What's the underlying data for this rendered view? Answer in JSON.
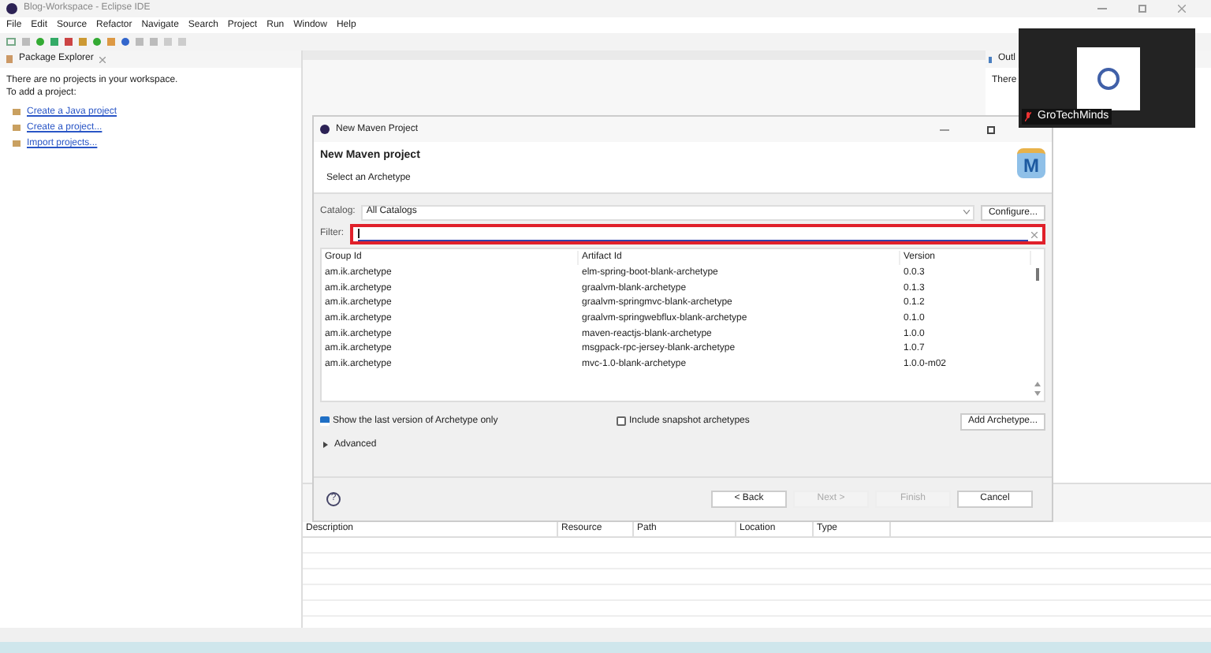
{
  "window": {
    "title": "Blog-Workspace - Eclipse IDE"
  },
  "menu": [
    "File",
    "Edit",
    "Source",
    "Refactor",
    "Navigate",
    "Search",
    "Project",
    "Run",
    "Window",
    "Help"
  ],
  "package_explorer": {
    "title": "Package Explorer",
    "message": [
      "There are no projects in your workspace.",
      "To add a project:"
    ],
    "links": [
      "Create a Java project",
      "Create a project...",
      "Import projects..."
    ]
  },
  "outline": {
    "title": "Outl",
    "text": "There"
  },
  "problems": {
    "columns": [
      "Description",
      "Resource",
      "Path",
      "Location",
      "Type"
    ]
  },
  "dialog": {
    "title": "New Maven Project",
    "heading": "New Maven project",
    "subtitle": "Select an Archetype",
    "catalog": {
      "label": "Catalog:",
      "value": "All Catalogs",
      "button": "Configure..."
    },
    "logo": "M",
    "filter": {
      "label": "Filter:"
    },
    "help": "?",
    "table": {
      "columns": [
        "Group Id",
        "Artifact Id",
        "Version"
      ],
      "rows": [
        {
          "cells": [
            "am.ik.archetype",
            "elm-spring-boot-blank-archetype",
            "0.0.3"
          ]
        },
        {
          "cells": [
            "am.ik.archetype",
            "graalvm-blank-archetype",
            "0.1.3"
          ]
        },
        {
          "cells": [
            "am.ik.archetype",
            "graalvm-springmvc-blank-archetype",
            "0.1.2"
          ]
        },
        {
          "cells": [
            "am.ik.archetype",
            "graalvm-springwebflux-blank-archetype",
            "0.1.0"
          ]
        },
        {
          "cells": [
            "am.ik.archetype",
            "maven-reactjs-blank-archetype",
            "1.0.0"
          ]
        },
        {
          "cells": [
            "am.ik.archetype",
            "msgpack-rpc-jersey-blank-archetype",
            "1.0.7"
          ]
        },
        {
          "cells": [
            "am.ik.archetype",
            "mvc-1.0-blank-archetype",
            "1.0.0-m02"
          ]
        }
      ]
    },
    "options": [
      {
        "label": "Show the last version of Archetype only",
        "checked": true
      },
      {
        "label": "Include snapshot archetypes",
        "checked": false
      }
    ],
    "add_button": "Add Archetype...",
    "advanced": {
      "label": "Advanced",
      "expanded": false
    },
    "buttons": [
      {
        "label": "< Back",
        "disabled": false
      },
      {
        "label": "Next >",
        "disabled": true
      },
      {
        "label": "Finish",
        "disabled": true
      },
      {
        "label": "Cancel",
        "disabled": false
      }
    ]
  },
  "video_overlay": {
    "name": "GroTechMinds"
  }
}
